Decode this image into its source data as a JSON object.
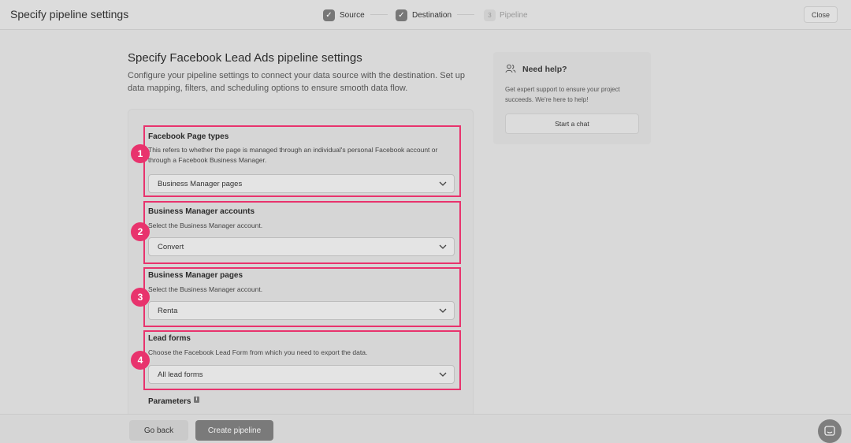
{
  "header": {
    "title": "Specify pipeline settings",
    "steps": [
      {
        "number": "",
        "label": "Source",
        "state": "done",
        "icon": "check-icon"
      },
      {
        "number": "",
        "label": "Destination",
        "state": "done",
        "icon": "check-icon"
      },
      {
        "number": "3",
        "label": "Pipeline",
        "state": "pending"
      }
    ],
    "close_label": "Close"
  },
  "main": {
    "title": "Specify Facebook Lead Ads pipeline settings",
    "description": "Configure your pipeline settings to connect your data source with the destination. Set up data mapping, filters, and scheduling options to ensure smooth data flow."
  },
  "form": {
    "sections": [
      {
        "badge": "1",
        "title": "Facebook Page types",
        "description": "This refers to whether the page is managed through an individual's personal Facebook account or through a Facebook Business Manager.",
        "value": "Business Manager pages"
      },
      {
        "badge": "2",
        "title": "Business Manager accounts",
        "description": "Select the Business Manager account.",
        "value": "Convert"
      },
      {
        "badge": "3",
        "title": "Business Manager pages",
        "description": "Select the Business Manager account.",
        "value": "Renta"
      },
      {
        "badge": "4",
        "title": "Lead forms",
        "description": "Choose the Facebook Lead Form from which you need to export the data.",
        "value": "All lead forms"
      }
    ],
    "parameters_title": "Parameters"
  },
  "help": {
    "title": "Need help?",
    "description": "Get expert support to ensure your project succeeds. We're here to help!",
    "chat_label": "Start a chat"
  },
  "footer": {
    "back_label": "Go back",
    "create_label": "Create pipeline"
  },
  "colors": {
    "highlight": "#e8336d",
    "background": "#d9d9d9",
    "primary_button": "#7a7a7a"
  }
}
